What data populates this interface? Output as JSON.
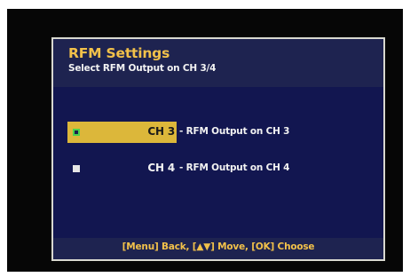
{
  "dialog": {
    "title": "RFM Settings",
    "subtitle": "Select RFM Output on CH 3/4"
  },
  "options": [
    {
      "channel": "CH 3",
      "description": "- RFM Output on CH 3",
      "selected": true,
      "icon": "checked-square-icon"
    },
    {
      "channel": "CH 4",
      "description": "- RFM Output on CH 4",
      "selected": false,
      "icon": "square-bullet-icon"
    }
  ],
  "footer": {
    "hint": "[Menu] Back, [▲▼] Move, [OK] Choose"
  },
  "colors": {
    "title": "#f2c14a",
    "panel_bg": "#121650",
    "header_bg": "#1e2350",
    "highlight": "#dcb73a",
    "icon_check": "#4bd14b"
  }
}
